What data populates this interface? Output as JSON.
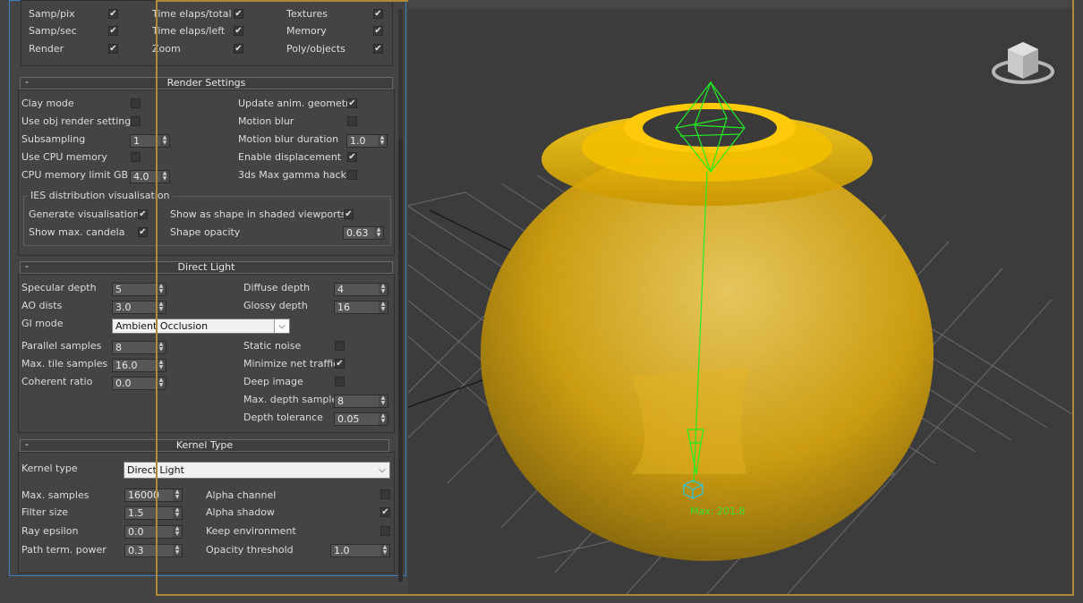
{
  "stats_section": {
    "rows": [
      {
        "col1": {
          "label": "Samp/pix",
          "checked": true
        },
        "col2": {
          "label": "Time elaps/total",
          "checked": true
        },
        "col3": {
          "label": "Textures",
          "checked": true
        }
      },
      {
        "col1": {
          "label": "Samp/sec",
          "checked": true
        },
        "col2": {
          "label": "Time elaps/left",
          "checked": true
        },
        "col3": {
          "label": "Memory",
          "checked": true
        }
      },
      {
        "col1": {
          "label": "Render",
          "checked": true
        },
        "col2": {
          "label": "Zoom",
          "checked": true
        },
        "col3": {
          "label": "Poly/objects",
          "checked": true
        }
      }
    ]
  },
  "render_settings": {
    "title": "Render Settings",
    "collapse": "-",
    "clay_mode": {
      "label": "Clay mode",
      "checked": false
    },
    "use_obj_render": {
      "label": "Use obj render settings",
      "checked": false
    },
    "subsampling": {
      "label": "Subsampling",
      "value": "1"
    },
    "use_cpu_memory": {
      "label": "Use CPU memory",
      "checked": false
    },
    "cpu_memory_limit": {
      "label": "CPU memory limit GB",
      "value": "4.0"
    },
    "update_anim": {
      "label": "Update anim. geometry",
      "checked": true
    },
    "motion_blur": {
      "label": "Motion blur",
      "checked": false
    },
    "motion_blur_duration": {
      "label": "Motion blur duration",
      "value": "1.0"
    },
    "enable_displacement": {
      "label": "Enable displacement",
      "checked": true
    },
    "gamma_hack": {
      "label": "3ds Max gamma hack",
      "checked": false
    },
    "ies": {
      "title": "IES distribution visualisation",
      "generate": {
        "label": "Generate visualisation",
        "checked": true
      },
      "show_candela": {
        "label": "Show max. candela",
        "checked": true
      },
      "show_shape": {
        "label": "Show as shape in shaded viewports",
        "checked": true
      },
      "shape_opacity": {
        "label": "Shape opacity",
        "value": "0.63"
      }
    }
  },
  "direct_light": {
    "title": "Direct Light",
    "collapse": "-",
    "specular_depth": {
      "label": "Specular depth",
      "value": "5"
    },
    "ao_dists": {
      "label": "AO dists",
      "value": "3.0"
    },
    "gi_mode": {
      "label": "GI mode",
      "value": "Ambient Occlusion"
    },
    "parallel_samples": {
      "label": "Parallel samples",
      "value": "8"
    },
    "max_tile_samples": {
      "label": "Max. tile samples",
      "value": "16.0"
    },
    "coherent_ratio": {
      "label": "Coherent ratio",
      "value": "0.0"
    },
    "diffuse_depth": {
      "label": "Diffuse depth",
      "value": "4"
    },
    "glossy_depth": {
      "label": "Glossy depth",
      "value": "16"
    },
    "static_noise": {
      "label": "Static noise",
      "checked": false
    },
    "minimize_net": {
      "label": "Minimize net traffic",
      "checked": true
    },
    "deep_image": {
      "label": "Deep image",
      "checked": false
    },
    "max_depth_samples": {
      "label": "Max. depth samples",
      "value": "8"
    },
    "depth_tolerance": {
      "label": "Depth tolerance",
      "value": "0.05"
    }
  },
  "kernel_type": {
    "title": "Kernel Type",
    "collapse": "-",
    "kernel": {
      "label": "Kernel type",
      "value": "Direct Light"
    },
    "max_samples": {
      "label": "Max. samples",
      "value": "16000"
    },
    "filter_size": {
      "label": "Filter size",
      "value": "1.5"
    },
    "ray_epsilon": {
      "label": "Ray epsilon",
      "value": "0.0"
    },
    "path_term_power": {
      "label": "Path term. power",
      "value": "0.3"
    },
    "alpha_channel": {
      "label": "Alpha channel",
      "checked": false
    },
    "alpha_shadow": {
      "label": "Alpha shadow",
      "checked": true
    },
    "keep_environment": {
      "label": "Keep environment",
      "checked": false
    },
    "opacity_threshold": {
      "label": "Opacity threshold",
      "value": "1.0"
    }
  },
  "viewport": {
    "light_label": "Max: 201.8",
    "colors": {
      "object": "#e8b400",
      "light_gizmo": "#22ee22",
      "grid": "#6b6b6b",
      "frame": "#b08a34",
      "panel_border": "#3b7fc4"
    },
    "nav_cube_icon": "viewcube-icon"
  }
}
